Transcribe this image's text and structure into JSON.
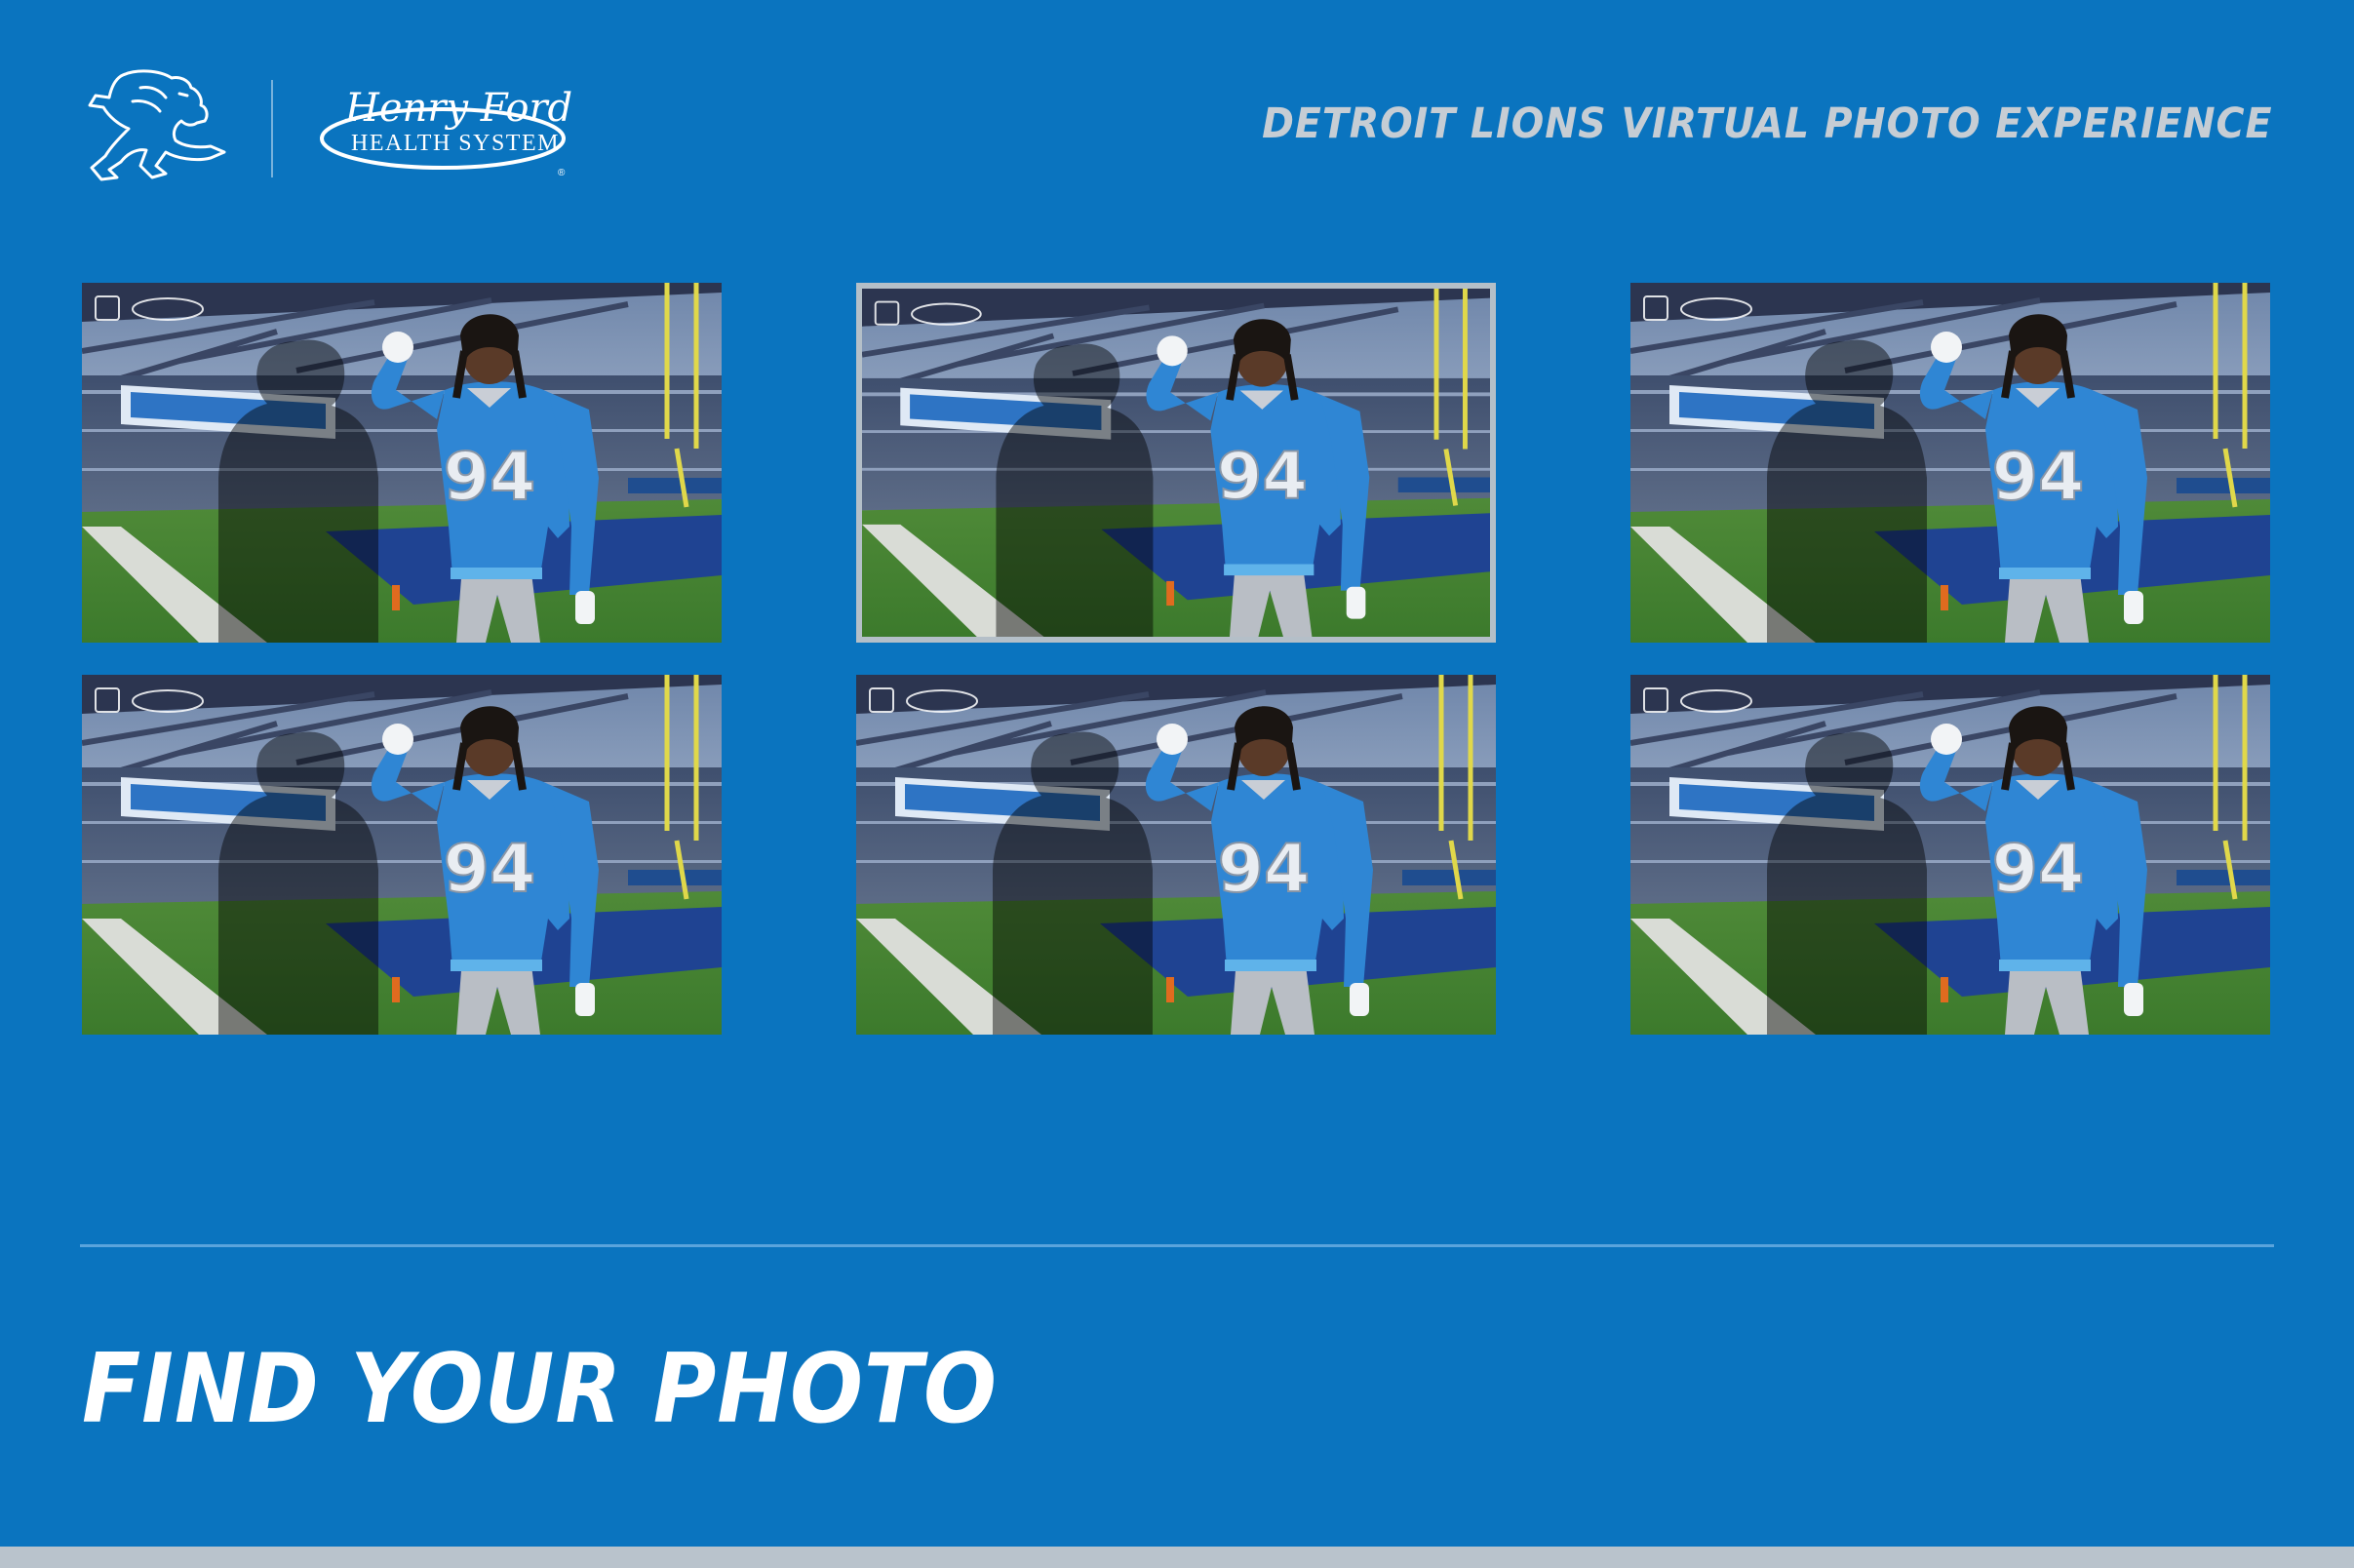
{
  "header": {
    "title": "DETROIT LIONS VIRTUAL PHOTO EXPERIENCE",
    "logo_lions": "lions-logo",
    "logo_partner_script": "Henry Ford",
    "logo_partner_subtitle": "HEALTH SYSTEM"
  },
  "gallery": {
    "photos": [
      {
        "jersey_number": "94",
        "selected": false
      },
      {
        "jersey_number": "94",
        "selected": true
      },
      {
        "jersey_number": "94",
        "selected": false
      },
      {
        "jersey_number": "94",
        "selected": false
      },
      {
        "jersey_number": "94",
        "selected": false
      },
      {
        "jersey_number": "94",
        "selected": false
      }
    ]
  },
  "find": {
    "title": "FIND YOUR PHOTO"
  },
  "colors": {
    "background": "#0a74bf",
    "header_text": "#c6cdd4",
    "jersey": "#2f86d4",
    "selected_border": "#b4bfc8",
    "footer_bar": "#b9c3cc"
  }
}
